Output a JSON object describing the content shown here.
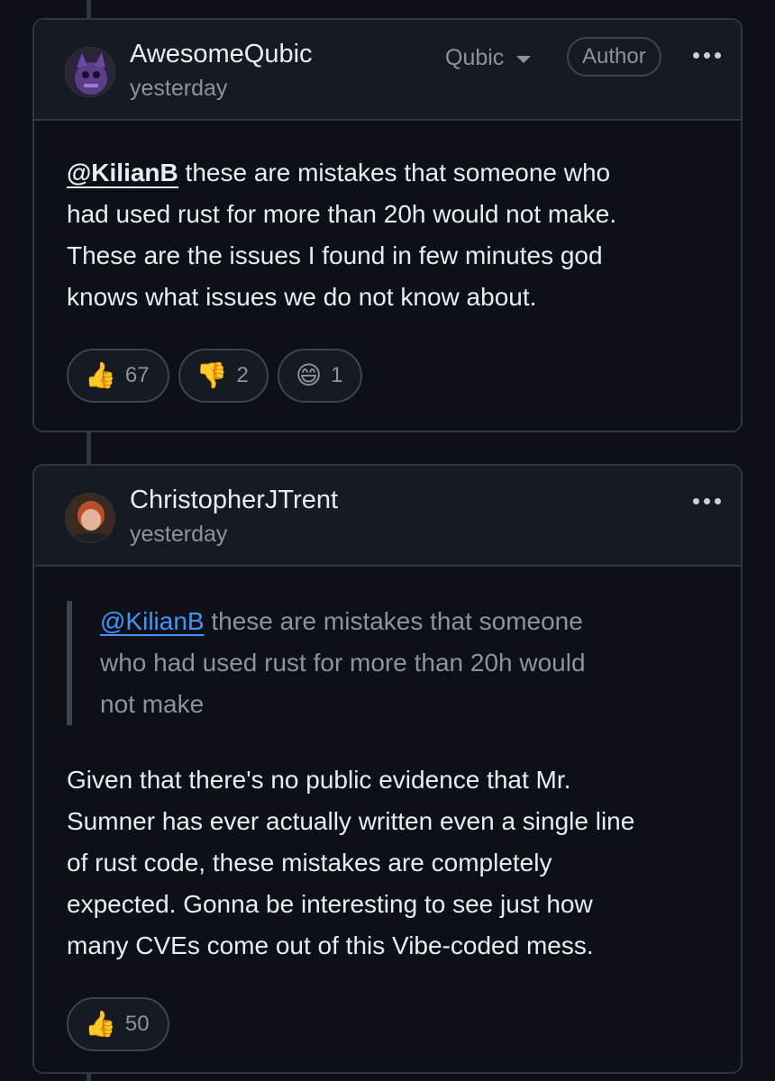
{
  "comments": [
    {
      "author": "AwesomeQubic",
      "timestamp": "yesterday",
      "role_select": "Qubic",
      "badge": "Author",
      "avatar_icon": "purple-creature-avatar",
      "mention": "@KilianB",
      "body_lines": [
        " these are mistakes that someone who",
        "had used rust for more than 20h would not make.",
        "These are the issues I found in few minutes god",
        "knows what issues we do not know about."
      ],
      "reactions": [
        {
          "emoji": "👍",
          "icon": "thumbs-up-icon",
          "count": "67"
        },
        {
          "emoji": "👎",
          "icon": "thumbs-down-icon",
          "count": "2"
        },
        {
          "emoji": "😄",
          "icon": "laugh-icon",
          "count": "1"
        }
      ]
    },
    {
      "author": "ChristopherJTrent",
      "timestamp": "yesterday",
      "avatar_icon": "red-hair-person-avatar",
      "quote": {
        "mention": "@KilianB",
        "lines": [
          " these are mistakes that someone",
          "who had used rust for more than 20h would",
          "not make"
        ]
      },
      "body_lines": [
        "Given that there's no public evidence that Mr.",
        "Sumner has ever actually written even a single line",
        "of rust code, these mistakes are completely",
        "expected. Gonna be interesting to see just how",
        "many CVEs come out of this Vibe-coded mess."
      ],
      "reactions": [
        {
          "emoji": "👍",
          "icon": "thumbs-up-icon",
          "count": "50"
        }
      ]
    }
  ],
  "colors": {
    "background": "#0d1117",
    "border": "#30363d",
    "text": "#e6edf3",
    "muted": "#8b949e",
    "link": "#4493f8"
  }
}
